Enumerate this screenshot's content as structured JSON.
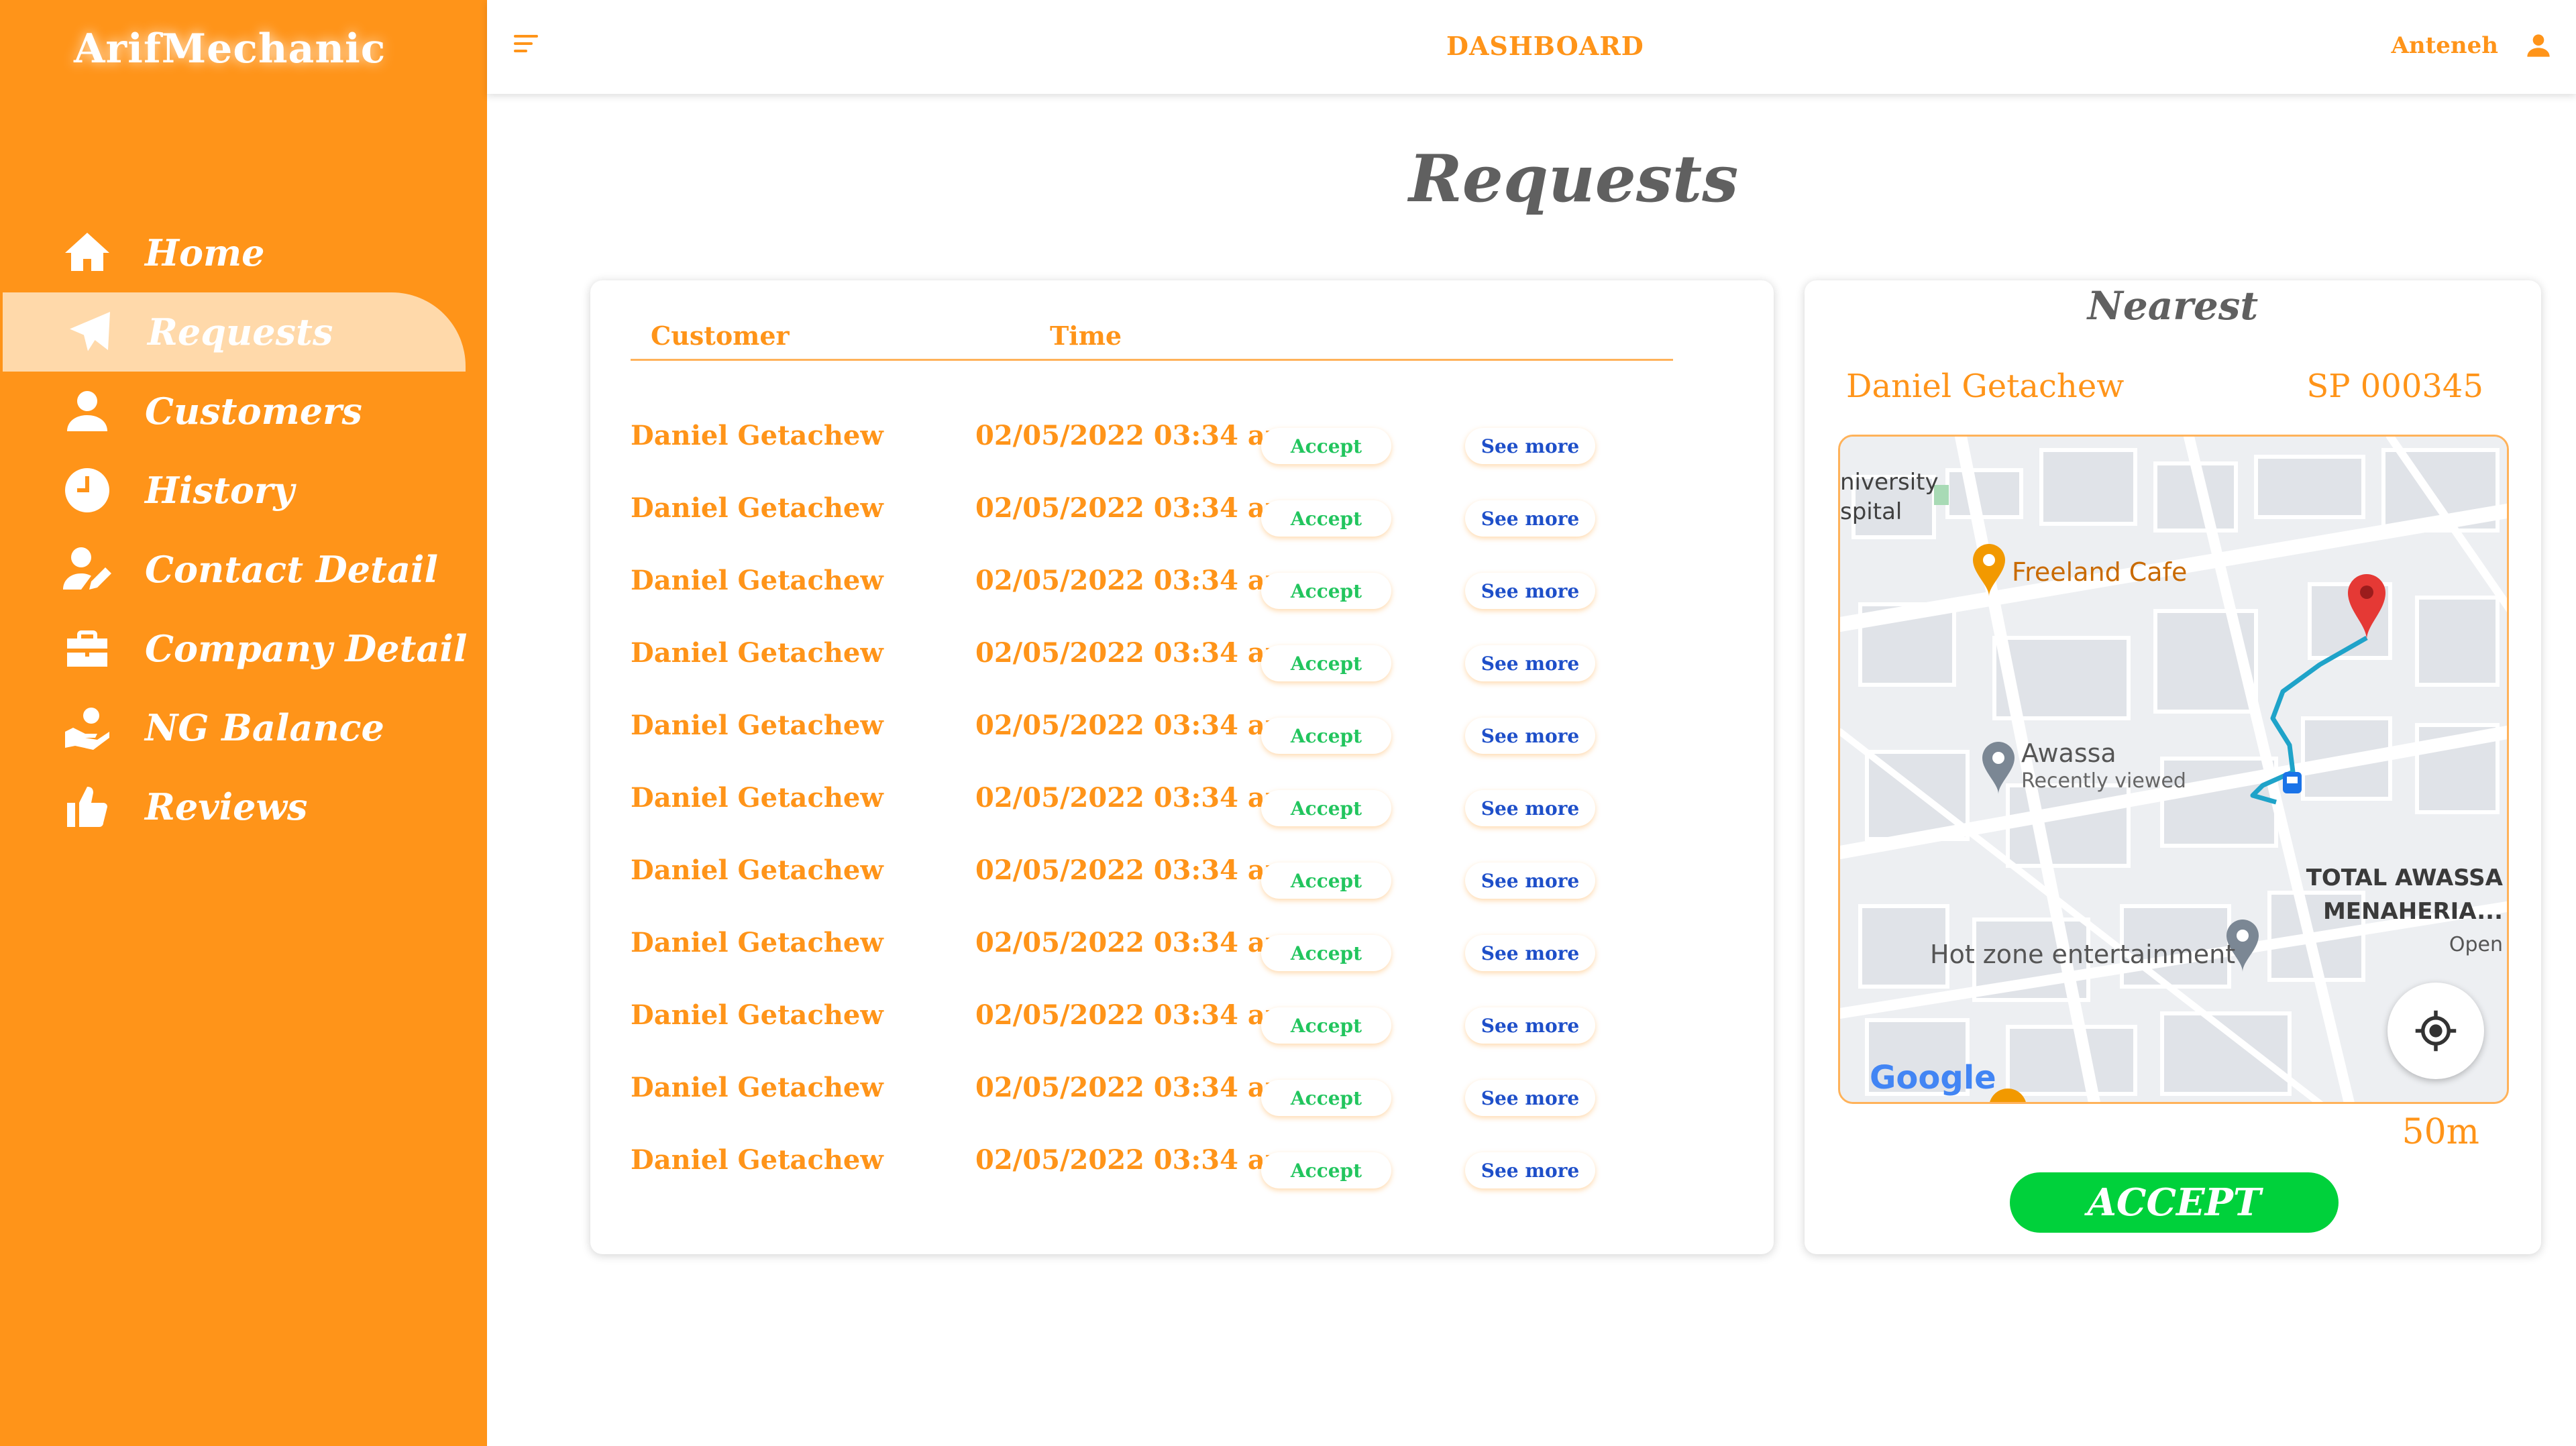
{
  "app": {
    "brand": "ArifMechanic"
  },
  "header": {
    "title": "DASHBOARD",
    "user_name": "Anteneh"
  },
  "sidebar": {
    "items": [
      {
        "label": "Home",
        "icon": "home-icon"
      },
      {
        "label": "Requests",
        "icon": "send-icon",
        "active": true
      },
      {
        "label": "Customers",
        "icon": "user-icon"
      },
      {
        "label": "History",
        "icon": "clock-icon"
      },
      {
        "label": "Contact Detail",
        "icon": "user-edit-icon"
      },
      {
        "label": "Company Detail",
        "icon": "briefcase-icon"
      },
      {
        "label": "NG Balance",
        "icon": "hand-coin-icon"
      },
      {
        "label": "Reviews",
        "icon": "thumbs-up-icon"
      }
    ]
  },
  "page": {
    "title": "Requests"
  },
  "requests": {
    "columns": {
      "customer": "Customer",
      "time": "Time"
    },
    "accept_label": "Accept",
    "see_more_label": "See more",
    "rows": [
      {
        "name": "Daniel Getachew",
        "time": "02/05/2022 03:34 am"
      },
      {
        "name": "Daniel Getachew",
        "time": "02/05/2022 03:34 am"
      },
      {
        "name": "Daniel Getachew",
        "time": "02/05/2022 03:34 am"
      },
      {
        "name": "Daniel Getachew",
        "time": "02/05/2022 03:34 am"
      },
      {
        "name": "Daniel Getachew",
        "time": "02/05/2022 03:34 am"
      },
      {
        "name": "Daniel Getachew",
        "time": "02/05/2022 03:34 am"
      },
      {
        "name": "Daniel Getachew",
        "time": "02/05/2022 03:34 am"
      },
      {
        "name": "Daniel Getachew",
        "time": "02/05/2022 03:34 am"
      },
      {
        "name": "Daniel Getachew",
        "time": "02/05/2022 03:34 am"
      },
      {
        "name": "Daniel Getachew",
        "time": "02/05/2022 03:34 am"
      },
      {
        "name": "Daniel Getachew",
        "time": "02/05/2022 03:34 am"
      }
    ]
  },
  "nearest": {
    "title": "Nearest",
    "name": "Daniel Getachew",
    "id": "SP 000345",
    "distance": "50m",
    "accept_label": "ACCEPT",
    "map": {
      "labels": {
        "hospital_1": "niversity",
        "hospital_2": "spital",
        "cafe": "Freeland Cafe",
        "place": "Awassa",
        "place_sub": "Recently viewed",
        "station_1": "TOTAL AWASSA",
        "station_2": "MENAHERIA...",
        "station_open": "Open",
        "entertainment": "Hot zone entertainment",
        "google": "Google"
      }
    }
  },
  "colors": {
    "accent": "#FF9419",
    "accept_green": "#00D13B",
    "link_blue": "#1E4FC9"
  }
}
